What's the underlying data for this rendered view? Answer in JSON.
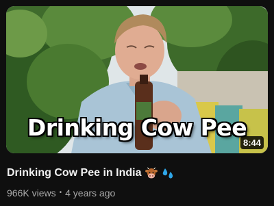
{
  "video": {
    "thumbnail_text": "Drinking Cow Pee",
    "duration": "8:44",
    "title": "Drinking Cow Pee in India",
    "title_emojis": [
      "cow-face-emoji",
      "sweat-droplets-emoji"
    ],
    "views": "966K views",
    "separator": "•",
    "age": "4 years ago"
  },
  "colors": {
    "background": "#0f0f0f",
    "title": "#f1f1f1",
    "meta": "#aaaaaa",
    "duration_badge": "#000000"
  }
}
